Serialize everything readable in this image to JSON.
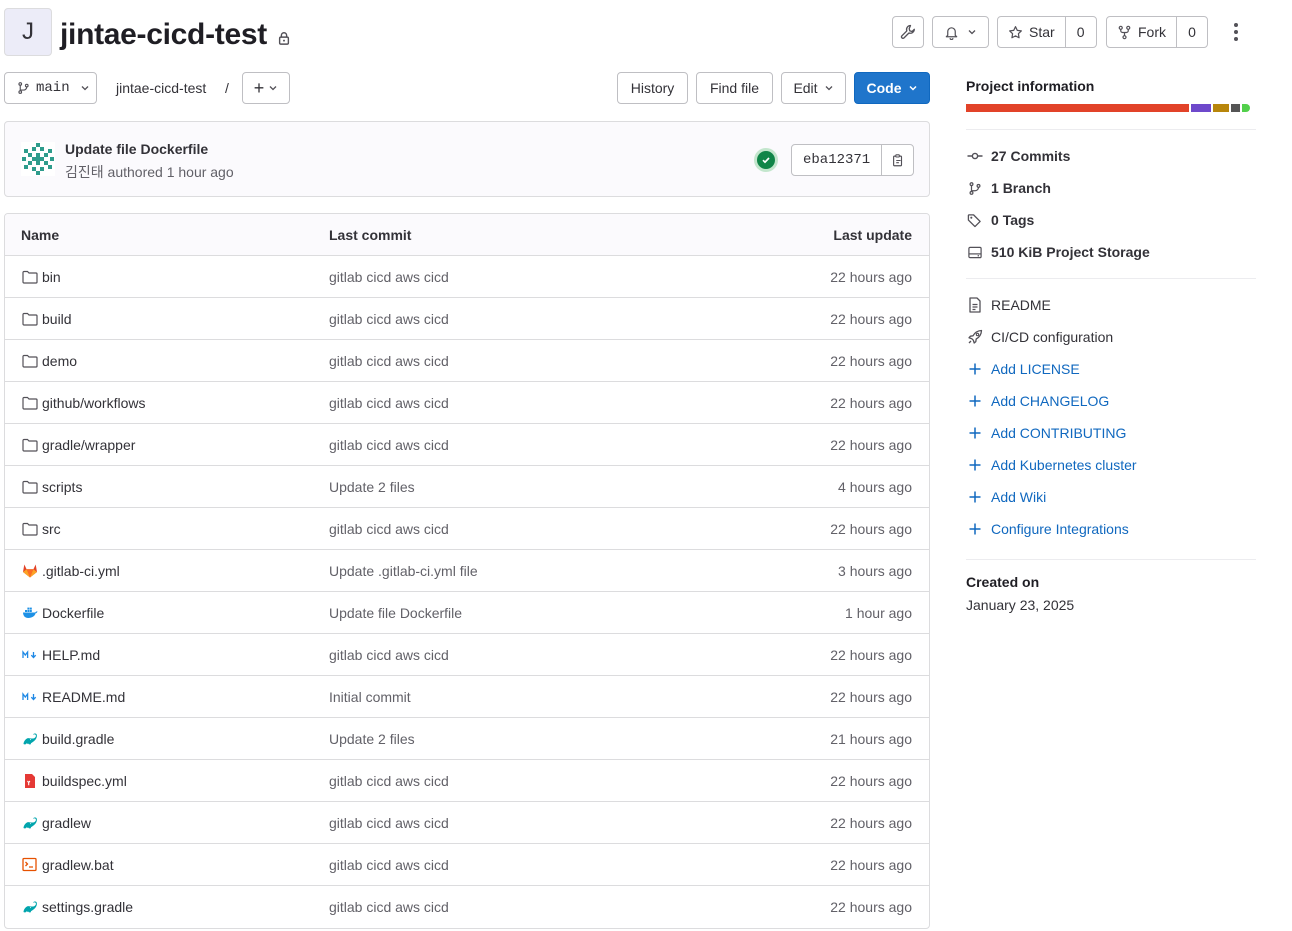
{
  "project": {
    "initial": "J",
    "name": "jintae-cicd-test",
    "lock_icon": "lock-icon"
  },
  "header_actions": {
    "settings_icon": "wrench-icon",
    "notification_icon": "bell-icon",
    "star_label": "Star",
    "star_count": "0",
    "fork_label": "Fork",
    "fork_count": "0"
  },
  "toolbar": {
    "branch": "main",
    "breadcrumb": "jintae-cicd-test",
    "separator": "/",
    "plus_label": "+",
    "history": "History",
    "find_file": "Find file",
    "edit": "Edit",
    "code": "Code"
  },
  "last_commit": {
    "title": "Update file Dockerfile",
    "author": "김진태",
    "authored_text": "authored 1 hour ago",
    "status": "passed",
    "sha": "eba12371"
  },
  "file_table": {
    "headers": {
      "name": "Name",
      "last_commit": "Last commit",
      "last_update": "Last update"
    },
    "rows": [
      {
        "icon": "folder-icon",
        "name": "bin",
        "commit": "gitlab cicd aws cicd",
        "updated": "22 hours ago"
      },
      {
        "icon": "folder-icon",
        "name": "build",
        "commit": "gitlab cicd aws cicd",
        "updated": "22 hours ago"
      },
      {
        "icon": "folder-icon",
        "name": "demo",
        "commit": "gitlab cicd aws cicd",
        "updated": "22 hours ago"
      },
      {
        "icon": "folder-icon",
        "name": "github/workflows",
        "commit": "gitlab cicd aws cicd",
        "updated": "22 hours ago"
      },
      {
        "icon": "folder-icon",
        "name": "gradle/wrapper",
        "commit": "gitlab cicd aws cicd",
        "updated": "22 hours ago"
      },
      {
        "icon": "folder-icon",
        "name": "scripts",
        "commit": "Update 2 files",
        "updated": "4 hours ago"
      },
      {
        "icon": "folder-icon",
        "name": "src",
        "commit": "gitlab cicd aws cicd",
        "updated": "22 hours ago"
      },
      {
        "icon": "gitlab-icon",
        "name": ".gitlab-ci.yml",
        "commit": "Update .gitlab-ci.yml file",
        "updated": "3 hours ago"
      },
      {
        "icon": "docker-icon",
        "name": "Dockerfile",
        "commit": "Update file Dockerfile",
        "updated": "1 hour ago"
      },
      {
        "icon": "markdown-icon",
        "name": "HELP.md",
        "commit": "gitlab cicd aws cicd",
        "updated": "22 hours ago"
      },
      {
        "icon": "markdown-icon",
        "name": "README.md",
        "commit": "Initial commit",
        "updated": "22 hours ago"
      },
      {
        "icon": "gradle-icon",
        "name": "build.gradle",
        "commit": "Update 2 files",
        "updated": "21 hours ago"
      },
      {
        "icon": "yaml-file-icon",
        "name": "buildspec.yml",
        "commit": "gitlab cicd aws cicd",
        "updated": "22 hours ago"
      },
      {
        "icon": "gradle-icon",
        "name": "gradlew",
        "commit": "gitlab cicd aws cicd",
        "updated": "22 hours ago"
      },
      {
        "icon": "terminal-file-icon",
        "name": "gradlew.bat",
        "commit": "gitlab cicd aws cicd",
        "updated": "22 hours ago"
      },
      {
        "icon": "gradle-icon",
        "name": "settings.gradle",
        "commit": "gitlab cicd aws cicd",
        "updated": "22 hours ago"
      }
    ]
  },
  "sidebar": {
    "title": "Project information",
    "languages": [
      {
        "color": "#e24329",
        "share": 0.79
      },
      {
        "color": "#6e49cb",
        "share": 0.07
      },
      {
        "color": "#b8860b",
        "share": 0.06
      },
      {
        "color": "#555555",
        "share": 0.03
      },
      {
        "color": "#52d04b",
        "share": 0.03
      }
    ],
    "stats": [
      {
        "icon": "commit-icon",
        "count": "27",
        "label": "Commits"
      },
      {
        "icon": "branch-icon",
        "count": "1",
        "label": "Branch"
      },
      {
        "icon": "tag-icon",
        "count": "0",
        "label": "Tags"
      },
      {
        "icon": "disk-icon",
        "count": "510 KiB",
        "label": "Project Storage"
      }
    ],
    "links": [
      {
        "icon": "document-icon",
        "label": "README",
        "style": "plain"
      },
      {
        "icon": "rocket-icon",
        "label": "CI/CD configuration",
        "style": "plain"
      },
      {
        "icon": "plus-icon",
        "label": "Add LICENSE",
        "style": "blue"
      },
      {
        "icon": "plus-icon",
        "label": "Add CHANGELOG",
        "style": "blue"
      },
      {
        "icon": "plus-icon",
        "label": "Add CONTRIBUTING",
        "style": "blue"
      },
      {
        "icon": "plus-icon",
        "label": "Add Kubernetes cluster",
        "style": "blue"
      },
      {
        "icon": "plus-icon",
        "label": "Add Wiki",
        "style": "blue"
      },
      {
        "icon": "plus-icon",
        "label": "Configure Integrations",
        "style": "blue"
      }
    ],
    "created_label": "Created on",
    "created_date": "January 23, 2025"
  }
}
